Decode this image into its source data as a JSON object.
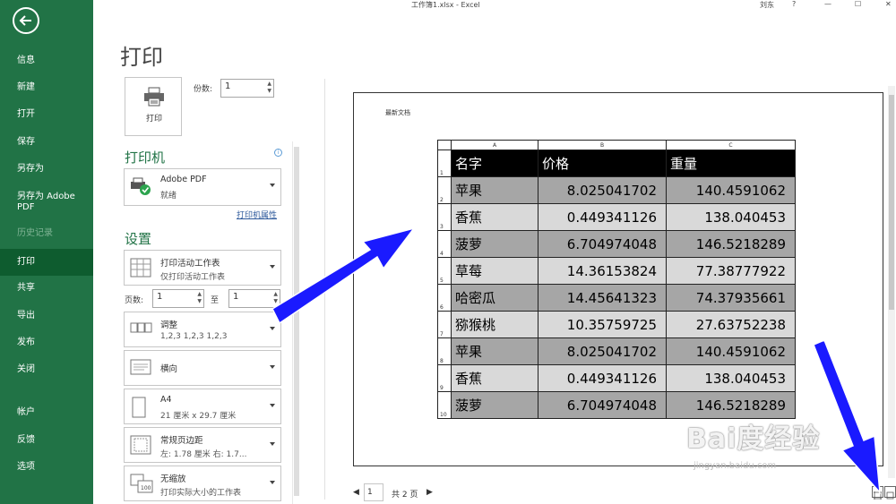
{
  "window": {
    "title": "工作簿1.xlsx  -  Excel",
    "user": "刘东",
    "help": "?",
    "minimize": "—",
    "maximize": "☐",
    "close": "✕"
  },
  "nav": {
    "items": [
      {
        "label": "信息"
      },
      {
        "label": "新建"
      },
      {
        "label": "打开"
      },
      {
        "label": "保存"
      },
      {
        "label": "另存为"
      },
      {
        "label": "另存为 Adobe PDF"
      },
      {
        "label": "历史记录"
      },
      {
        "label": "打印"
      },
      {
        "label": "共享"
      },
      {
        "label": "导出"
      },
      {
        "label": "发布"
      },
      {
        "label": "关闭"
      },
      {
        "label": "帐户"
      },
      {
        "label": "反馈"
      },
      {
        "label": "选项"
      }
    ],
    "active": "打印"
  },
  "print": {
    "page_title": "打印",
    "button_label": "打印",
    "copies_label": "份数:",
    "copies_value": "1",
    "printer_header": "打印机",
    "printer_name": "Adobe PDF",
    "printer_status": "就绪",
    "printer_props": "打印机属性",
    "settings_header": "设置",
    "setting_scope": {
      "l1": "打印活动工作表",
      "l2": "仅打印活动工作表"
    },
    "pages_label": "页数:",
    "pages_from": "1",
    "to_label": "至",
    "pages_to": "1",
    "collate": {
      "l1": "调整",
      "l2": "1,2,3    1,2,3    1,2,3"
    },
    "orientation": {
      "l1": "横向",
      "l2": ""
    },
    "paper": {
      "l1": "A4",
      "l2": "21 厘米 x 29.7 厘米"
    },
    "margins": {
      "l1": "常规页边距",
      "l2": "左: 1.78 厘米    右: 1.7..."
    },
    "scaling": {
      "l1": "无缩放",
      "l2": "打印实际大小的工作表"
    }
  },
  "preview": {
    "sheet_name": "最新文档",
    "columns": [
      "A",
      "B",
      "C"
    ],
    "rows": [
      {
        "n": "1",
        "a": "名字",
        "b": "价格",
        "c": "重量"
      },
      {
        "n": "2",
        "a": "苹果",
        "b": "8.025041702",
        "c": "140.4591062"
      },
      {
        "n": "3",
        "a": "香蕉",
        "b": "0.449341126",
        "c": "138.040453"
      },
      {
        "n": "4",
        "a": "菠萝",
        "b": "6.704974048",
        "c": "146.5218289"
      },
      {
        "n": "5",
        "a": "草莓",
        "b": "14.36153824",
        "c": "77.38777922"
      },
      {
        "n": "6",
        "a": "哈密瓜",
        "b": "14.45641323",
        "c": "74.37935661"
      },
      {
        "n": "7",
        "a": "猕猴桃",
        "b": "10.35759725",
        "c": "27.63752238"
      },
      {
        "n": "8",
        "a": "苹果",
        "b": "8.025041702",
        "c": "140.4591062"
      },
      {
        "n": "9",
        "a": "香蕉",
        "b": "0.449341126",
        "c": "138.040453"
      },
      {
        "n": "10",
        "a": "菠萝",
        "b": "6.704974048",
        "c": "146.5218289"
      }
    ]
  },
  "pager": {
    "current": "1",
    "total": "共 2 页",
    "prev": "◀",
    "next": "▶"
  },
  "watermark": {
    "big": "Bai度经验",
    "small": "jingyan.baidu.com"
  },
  "colors": {
    "brand": "#217346",
    "nav_active": "#0e5c2f",
    "annotation_arrow": "#1a1aff"
  }
}
